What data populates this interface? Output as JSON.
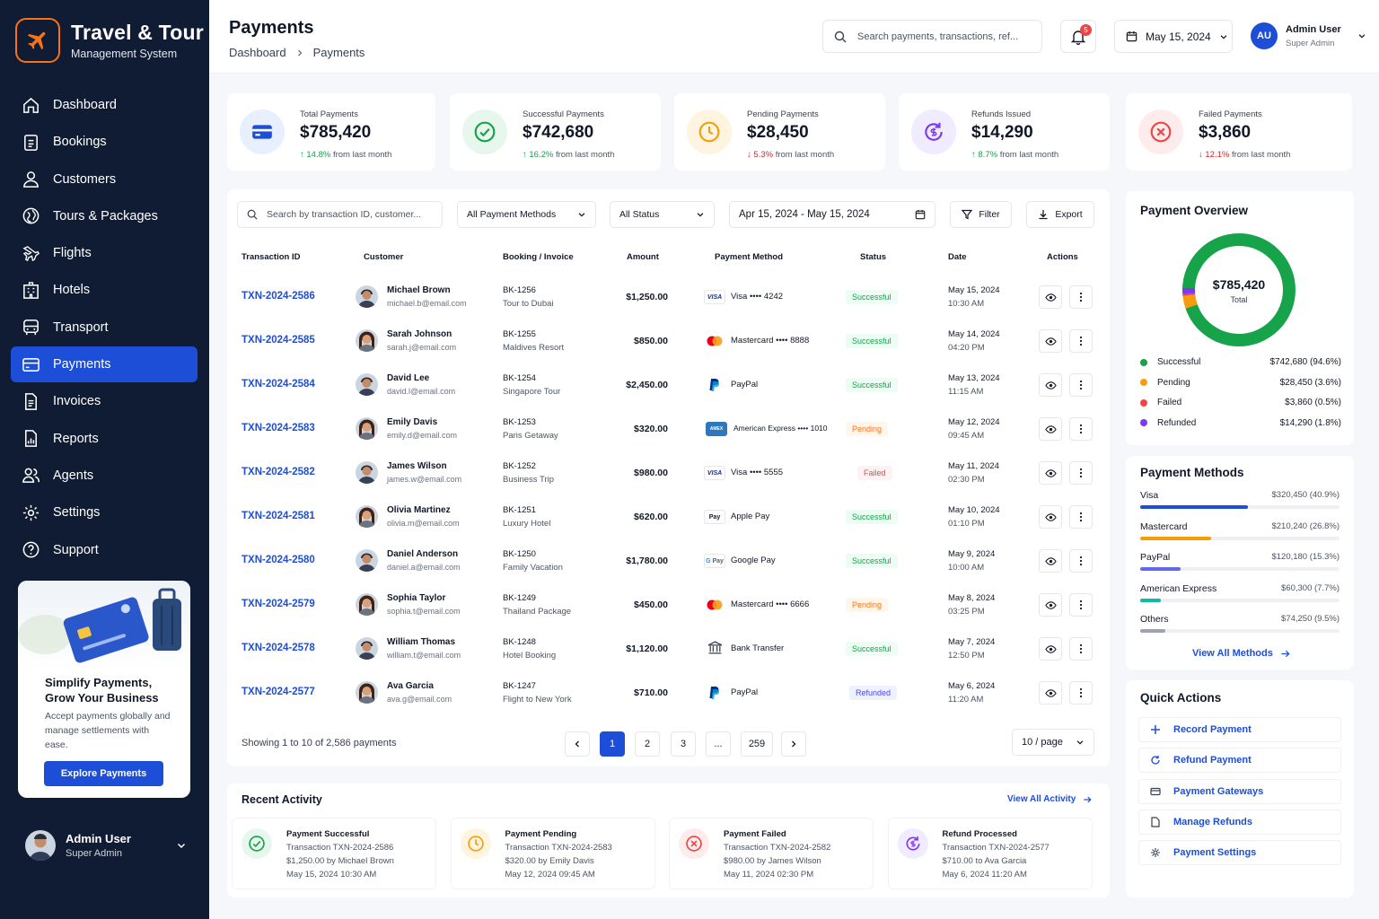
{
  "brand": {
    "title": "Travel & Tour",
    "subtitle": "Management System"
  },
  "nav": [
    {
      "label": "Dashboard",
      "icon": "home-icon"
    },
    {
      "label": "Bookings",
      "icon": "clipboard-icon"
    },
    {
      "label": "Customers",
      "icon": "user-icon"
    },
    {
      "label": "Tours & Packages",
      "icon": "globe-icon"
    },
    {
      "label": "Flights",
      "icon": "plane-icon"
    },
    {
      "label": "Hotels",
      "icon": "building-icon"
    },
    {
      "label": "Transport",
      "icon": "bus-icon"
    },
    {
      "label": "Payments",
      "icon": "card-icon",
      "active": true
    },
    {
      "label": "Invoices",
      "icon": "document-icon"
    },
    {
      "label": "Reports",
      "icon": "report-icon"
    },
    {
      "label": "Agents",
      "icon": "users-icon"
    },
    {
      "label": "Settings",
      "icon": "gear-icon"
    },
    {
      "label": "Support",
      "icon": "help-icon"
    }
  ],
  "promo": {
    "title": "Simplify Payments, Grow Your Business",
    "text": "Accept payments globally and manage settlements with ease.",
    "button": "Explore Payments"
  },
  "sidebar_user": {
    "name": "Admin User",
    "role": "Super Admin"
  },
  "header": {
    "title": "Payments",
    "breadcrumb": [
      "Dashboard",
      "Payments"
    ],
    "search_placeholder": "Search payments, transactions, ref...",
    "notifications": "5",
    "date": "May 15, 2024",
    "user_initials": "AU",
    "user_name": "Admin User",
    "user_role": "Super Admin"
  },
  "stats": [
    {
      "label": "Total Payments",
      "value": "$785,420",
      "change": "14.8%",
      "dir": "up",
      "suffix": "from last month",
      "color": "#1d4ed8",
      "bg": "#e8efff",
      "icon": "card-icon"
    },
    {
      "label": "Successful Payments",
      "value": "$742,680",
      "change": "16.2%",
      "dir": "up",
      "suffix": "from last month",
      "color": "#16a34a",
      "bg": "#e8f7ee",
      "icon": "check-circle-icon"
    },
    {
      "label": "Pending Payments",
      "value": "$28,450",
      "change": "5.3%",
      "dir": "down",
      "suffix": "from last month",
      "color": "#f59e0b",
      "bg": "#fff4e0",
      "icon": "clock-icon"
    },
    {
      "label": "Refunds Issued",
      "value": "$14,290",
      "change": "8.7%",
      "dir": "up",
      "suffix": "from last month",
      "color": "#7c3aed",
      "bg": "#f0ebff",
      "icon": "refund-icon"
    },
    {
      "label": "Failed Payments",
      "value": "$3,860",
      "change": "12.1%",
      "dir": "down",
      "suffix": "from last month",
      "color": "#ef4444",
      "bg": "#feecec",
      "icon": "x-circle-icon"
    }
  ],
  "filters": {
    "search_placeholder": "Search by transaction ID, customer...",
    "method": "All Payment Methods",
    "status": "All Status",
    "date_range": "Apr 15, 2024 - May 15, 2024",
    "filter": "Filter",
    "export": "Export"
  },
  "columns": [
    "Transaction ID",
    "Customer",
    "Booking / Invoice",
    "Amount",
    "Payment Method",
    "Status",
    "Date",
    "Actions"
  ],
  "rows": [
    {
      "id": "TXN-2024-2586",
      "name": "Michael Brown",
      "email": "michael.b@email.com",
      "bk": "BK-1256",
      "desc": "Tour to Dubai",
      "amount": "$1,250.00",
      "method": "Visa •••• 4242",
      "logo": "visa",
      "status": "Successful",
      "date": "May 15, 2024",
      "time": "10:30 AM",
      "g": "m"
    },
    {
      "id": "TXN-2024-2585",
      "name": "Sarah Johnson",
      "email": "sarah.j@email.com",
      "bk": "BK-1255",
      "desc": "Maldives Resort",
      "amount": "$850.00",
      "method": "Mastercard •••• 8888",
      "logo": "mc",
      "status": "Successful",
      "date": "May 14, 2024",
      "time": "04:20 PM",
      "g": "f"
    },
    {
      "id": "TXN-2024-2584",
      "name": "David Lee",
      "email": "david.l@email.com",
      "bk": "BK-1254",
      "desc": "Singapore Tour",
      "amount": "$2,450.00",
      "method": "PayPal",
      "logo": "pp",
      "status": "Successful",
      "date": "May 13, 2024",
      "time": "11:15 AM",
      "g": "m"
    },
    {
      "id": "TXN-2024-2583",
      "name": "Emily Davis",
      "email": "emily.d@email.com",
      "bk": "BK-1253",
      "desc": "Paris Getaway",
      "amount": "$320.00",
      "method": "American Express •••• 1010",
      "logo": "amex",
      "status": "Pending",
      "date": "May 12, 2024",
      "time": "09:45 AM",
      "g": "f"
    },
    {
      "id": "TXN-2024-2582",
      "name": "James Wilson",
      "email": "james.w@email.com",
      "bk": "BK-1252",
      "desc": "Business Trip",
      "amount": "$980.00",
      "method": "Visa •••• 5555",
      "logo": "visa",
      "status": "Failed",
      "date": "May 11, 2024",
      "time": "02:30 PM",
      "g": "m"
    },
    {
      "id": "TXN-2024-2581",
      "name": "Olivia Martinez",
      "email": "olivia.m@email.com",
      "bk": "BK-1251",
      "desc": "Luxury Hotel",
      "amount": "$620.00",
      "method": "Apple Pay",
      "logo": "apple",
      "status": "Successful",
      "date": "May 10, 2024",
      "time": "01:10 PM",
      "g": "f"
    },
    {
      "id": "TXN-2024-2580",
      "name": "Daniel Anderson",
      "email": "daniel.a@email.com",
      "bk": "BK-1250",
      "desc": "Family Vacation",
      "amount": "$1,780.00",
      "method": "Google Pay",
      "logo": "gpay",
      "status": "Successful",
      "date": "May 9, 2024",
      "time": "10:00 AM",
      "g": "m"
    },
    {
      "id": "TXN-2024-2579",
      "name": "Sophia Taylor",
      "email": "sophia.t@email.com",
      "bk": "BK-1249",
      "desc": "Thailand Package",
      "amount": "$450.00",
      "method": "Mastercard •••• 6666",
      "logo": "mc",
      "status": "Pending",
      "date": "May 8, 2024",
      "time": "03:25 PM",
      "g": "f"
    },
    {
      "id": "TXN-2024-2578",
      "name": "William Thomas",
      "email": "william.t@email.com",
      "bk": "BK-1248",
      "desc": "Hotel Booking",
      "amount": "$1,120.00",
      "method": "Bank Transfer",
      "logo": "bank",
      "status": "Successful",
      "date": "May 7, 2024",
      "time": "12:50 PM",
      "g": "m"
    },
    {
      "id": "TXN-2024-2577",
      "name": "Ava Garcia",
      "email": "ava.g@email.com",
      "bk": "BK-1247",
      "desc": "Flight to New York",
      "amount": "$710.00",
      "method": "PayPal",
      "logo": "pp",
      "status": "Refunded",
      "date": "May 6, 2024",
      "time": "11:20 AM",
      "g": "f"
    }
  ],
  "pagination": {
    "summary": "Showing 1 to 10 of 2,586 payments",
    "pages": [
      "1",
      "2",
      "3",
      "...",
      "259"
    ],
    "current": "1",
    "per_page": "10 / page"
  },
  "overview": {
    "title": "Payment Overview",
    "total": "$785,420",
    "total_label": "Total",
    "items": [
      {
        "label": "Successful",
        "value": "$742,680 (94.6%)",
        "pct": 94.6,
        "color": "#16a34a"
      },
      {
        "label": "Pending",
        "value": "$28,450 (3.6%)",
        "pct": 3.6,
        "color": "#f59e0b"
      },
      {
        "label": "Failed",
        "value": "$3,860 (0.5%)",
        "pct": 0.5,
        "color": "#ef4444"
      },
      {
        "label": "Refunded",
        "value": "$14,290 (1.8%)",
        "pct": 1.8,
        "color": "#7c3aed"
      }
    ]
  },
  "methods": {
    "title": "Payment Methods",
    "link": "View All Methods",
    "items": [
      {
        "label": "Visa",
        "value": "$320,450 (40.9%)",
        "pct": 40.9,
        "color": "#1d4ed8"
      },
      {
        "label": "Mastercard",
        "value": "$210,240 (26.8%)",
        "pct": 26.8,
        "color": "#f59e0b"
      },
      {
        "label": "PayPal",
        "value": "$120,180 (15.3%)",
        "pct": 15.3,
        "color": "#6366f1"
      },
      {
        "label": "American Express",
        "value": "$60,300 (7.7%)",
        "pct": 7.7,
        "color": "#14b8a6"
      },
      {
        "label": "Others",
        "value": "$74,250 (9.5%)",
        "pct": 9.5,
        "color": "#9ca3af"
      }
    ]
  },
  "quick": {
    "title": "Quick Actions",
    "items": [
      "Record Payment",
      "Refund Payment",
      "Payment Gateways",
      "Manage Refunds",
      "Payment Settings"
    ]
  },
  "activity": {
    "title": "Recent Activity",
    "link": "View All Activity",
    "items": [
      {
        "title": "Payment Successful",
        "l1": "Transaction TXN-2024-2586",
        "l2": "$1,250.00 by Michael Brown",
        "l3": "May 15, 2024 10:30 AM",
        "color": "#16a34a",
        "bg": "#e8f7ee",
        "icon": "check-circle-icon"
      },
      {
        "title": "Payment Pending",
        "l1": "Transaction TXN-2024-2583",
        "l2": "$320.00 by Emily Davis",
        "l3": "May 12, 2024 09:45 AM",
        "color": "#f59e0b",
        "bg": "#fff4e0",
        "icon": "clock-icon"
      },
      {
        "title": "Payment Failed",
        "l1": "Transaction TXN-2024-2582",
        "l2": "$980.00 by James Wilson",
        "l3": "May 11, 2024 02:30 PM",
        "color": "#ef4444",
        "bg": "#feecec",
        "icon": "x-circle-icon"
      },
      {
        "title": "Refund Processed",
        "l1": "Transaction TXN-2024-2577",
        "l2": "$710.00 to Ava Garcia",
        "l3": "May 6, 2024 11:20 AM",
        "color": "#7c3aed",
        "bg": "#f0ebff",
        "icon": "refund-icon"
      }
    ]
  }
}
